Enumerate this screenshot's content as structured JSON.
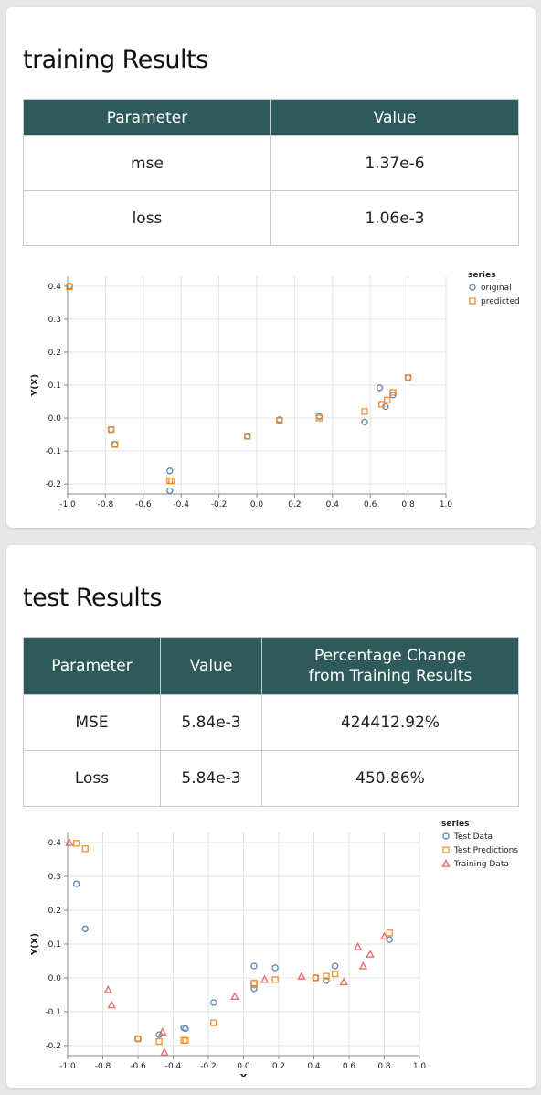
{
  "colors": {
    "header_bg": "#2f5a5b",
    "original": "#4c78a8",
    "predicted": "#f58518",
    "training": "#e45756"
  },
  "training": {
    "title": "training Results",
    "table": {
      "headers": [
        "Parameter",
        "Value"
      ],
      "rows": [
        [
          "mse",
          "1.37e-6"
        ],
        [
          "loss",
          "1.06e-3"
        ]
      ]
    }
  },
  "test": {
    "title": "test Results",
    "table": {
      "headers": [
        "Parameter",
        "Value",
        "Percentage Change from Training Results"
      ],
      "header_lines": [
        "Percentage Change",
        "from Training Results"
      ],
      "rows": [
        [
          "MSE",
          "5.84e-3",
          "424412.92%"
        ],
        [
          "Loss",
          "5.84e-3",
          "450.86%"
        ]
      ]
    }
  },
  "chart_data": [
    {
      "type": "scatter",
      "xlabel": "X",
      "ylabel": "Y(X)",
      "xlim": [
        -1.0,
        1.0
      ],
      "ylim": [
        -0.23,
        0.43
      ],
      "xticks": [
        -1.0,
        -0.8,
        -0.6,
        -0.4,
        -0.2,
        0.0,
        0.2,
        0.4,
        0.6,
        0.8,
        1.0
      ],
      "yticks": [
        -0.2,
        -0.1,
        0.0,
        0.1,
        0.2,
        0.3,
        0.4
      ],
      "grid": true,
      "legend_title": "series",
      "legend_position": "top-right",
      "series": [
        {
          "name": "original",
          "shape": "circle",
          "color": "#4c78a8",
          "x": [
            -0.99,
            -0.77,
            -0.75,
            -0.46,
            -0.46,
            -0.05,
            0.12,
            0.33,
            0.57,
            0.65,
            0.68,
            0.72,
            0.8
          ],
          "y": [
            0.4,
            -0.035,
            -0.08,
            -0.16,
            -0.22,
            -0.055,
            -0.005,
            0.005,
            -0.012,
            0.092,
            0.035,
            0.07,
            0.123
          ]
        },
        {
          "name": "predicted",
          "shape": "square",
          "color": "#f58518",
          "x": [
            -0.99,
            -0.77,
            -0.75,
            -0.46,
            -0.45,
            -0.05,
            0.12,
            0.33,
            0.57,
            0.66,
            0.69,
            0.72,
            0.8
          ],
          "y": [
            0.398,
            -0.035,
            -0.08,
            -0.19,
            -0.19,
            -0.055,
            -0.008,
            0.0,
            0.02,
            0.042,
            0.055,
            0.078,
            0.123
          ]
        }
      ]
    },
    {
      "type": "scatter",
      "xlabel": "X",
      "ylabel": "Y(X)",
      "xlim": [
        -1.0,
        1.0
      ],
      "ylim": [
        -0.23,
        0.43
      ],
      "xticks": [
        -1.0,
        -0.8,
        -0.6,
        -0.4,
        -0.2,
        0.0,
        0.2,
        0.4,
        0.6,
        0.8,
        1.0
      ],
      "yticks": [
        -0.2,
        -0.1,
        0.0,
        0.1,
        0.2,
        0.3,
        0.4
      ],
      "grid": true,
      "legend_title": "series",
      "legend_position": "top-right",
      "series": [
        {
          "name": "Test Data",
          "shape": "circle",
          "color": "#4c78a8",
          "x": [
            -0.95,
            -0.9,
            -0.6,
            -0.48,
            -0.34,
            -0.33,
            -0.17,
            0.06,
            0.06,
            0.18,
            0.41,
            0.47,
            0.52,
            0.83
          ],
          "y": [
            0.278,
            0.145,
            -0.18,
            -0.168,
            -0.148,
            -0.15,
            -0.073,
            -0.032,
            0.035,
            0.03,
            0.0,
            -0.008,
            0.035,
            0.113
          ]
        },
        {
          "name": "Test Predictions",
          "shape": "square",
          "color": "#f58518",
          "x": [
            -0.95,
            -0.9,
            -0.6,
            -0.48,
            -0.34,
            -0.33,
            -0.17,
            0.06,
            0.06,
            0.18,
            0.41,
            0.47,
            0.52,
            0.83
          ],
          "y": [
            0.398,
            0.382,
            -0.18,
            -0.188,
            -0.185,
            -0.185,
            -0.133,
            -0.02,
            -0.015,
            -0.005,
            0.0,
            0.005,
            0.012,
            0.133
          ]
        },
        {
          "name": "Training Data",
          "shape": "triangle",
          "color": "#e45756",
          "x": [
            -0.99,
            -0.77,
            -0.75,
            -0.46,
            -0.45,
            -0.05,
            0.12,
            0.33,
            0.57,
            0.65,
            0.68,
            0.72,
            0.8
          ],
          "y": [
            0.4,
            -0.035,
            -0.08,
            -0.16,
            -0.22,
            -0.055,
            -0.005,
            0.005,
            -0.012,
            0.092,
            0.035,
            0.07,
            0.123
          ]
        }
      ]
    }
  ]
}
